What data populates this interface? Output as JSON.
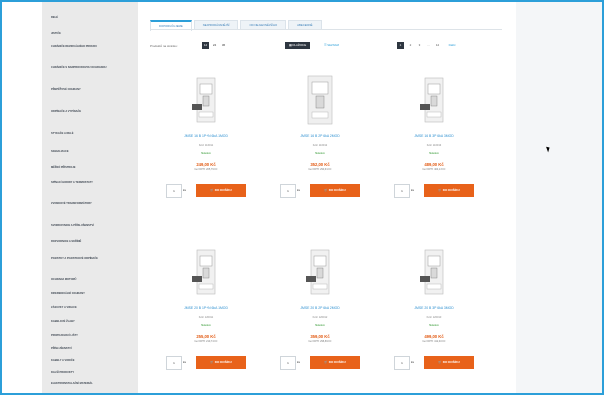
{
  "sidebar": {
    "items": [
      {
        "label": "RELÉ"
      },
      {
        "label": "JISTIČE"
      },
      {
        "label": "CHRÁNIČE REZIDUÁLNÍHO PROUDU"
      },
      {
        "label": "CHRÁNIČE S NADPROUDOVOU OCHRANOU"
      },
      {
        "label": "PŘEPĚŤOVÉ OCHRANY"
      },
      {
        "label": "ODPÍNAČE A VYPÍNAČE"
      },
      {
        "label": "STYKAČE A RELÉ"
      },
      {
        "label": "SIGNALIZACE"
      },
      {
        "label": "MĚŘICÍ PŘÍSTROJE"
      },
      {
        "label": "SPÍNACÍ HODINY A TERMOSTATY"
      },
      {
        "label": "ZVONKOVÉ TRANSFORMÁTORY"
      },
      {
        "label": "SVORKOVNICE A PŘÍSLUŠENSTVÍ"
      },
      {
        "label": "ROZVODNICE A SKŘÍNĚ"
      },
      {
        "label": "POJISTKY A POJISTKOVÉ ODPÍNAČE"
      },
      {
        "label": "OCHRANA MOTORŮ"
      },
      {
        "label": "DIFERENCIÁLNÍ OCHRANY"
      },
      {
        "label": "ZÁSUVKY A VIDLICE"
      },
      {
        "label": "KABELOVÉ ŽLABY"
      },
      {
        "label": "PROPOJOVACÍ LIŠTY"
      },
      {
        "label": "PŘÍSLUŠENSTVÍ"
      },
      {
        "label": "KABELY A VODIČE"
      },
      {
        "label": "DALŠÍ PRODUKTY"
      },
      {
        "label": "ELEKTROINSTALAČNÍ MATERIÁL"
      }
    ]
  },
  "tabs": [
    {
      "label": "DOPORUČUJEME"
    },
    {
      "label": "NEJPRODÁVANĚJŠÍ"
    },
    {
      "label": "OD NEJLEVNĚJŠÍHO"
    },
    {
      "label": "ABECEDNĚ"
    }
  ],
  "toolbar": {
    "per_page_label": "Produktů na stránku:",
    "per_page": [
      "12",
      "24",
      "36"
    ],
    "grid_label": "DLAŽDICE",
    "list_label": "SEZNAM",
    "pages": [
      "1",
      "2",
      "3",
      "...",
      "12"
    ],
    "next_label": "Další"
  },
  "products": [
    {
      "name": "JMSE 16 B 1P+N 6kA 1MOD",
      "code": "Kód: 116011",
      "stock": "Skladem",
      "price": "249,00 Kč",
      "vat": "bez DPH: 205,79 Kč",
      "qty": "1",
      "unit": "ks",
      "cart_label": "DO KOŠÍKU"
    },
    {
      "name": "JMSE 16 B 2P 6kA 2MOD",
      "code": "Kód: 116012",
      "stock": "Skladem",
      "price": "352,00 Kč",
      "vat": "bez DPH: 290,91 Kč",
      "qty": "1",
      "unit": "ks",
      "cart_label": "DO KOŠÍKU"
    },
    {
      "name": "JMSE 16 B 3P 6kA 3MOD",
      "code": "Kód: 116013",
      "stock": "Skladem",
      "price": "489,00 Kč",
      "vat": "bez DPH: 404,13 Kč",
      "qty": "1",
      "unit": "ks",
      "cart_label": "DO KOŠÍKU"
    },
    {
      "name": "JMSE 20 B 1P+N 6kA 1MOD",
      "code": "Kód: 120011",
      "stock": "Skladem",
      "price": "255,00 Kč",
      "vat": "bez DPH: 210,74 Kč",
      "qty": "1",
      "unit": "ks",
      "cart_label": "DO KOŠÍKU"
    },
    {
      "name": "JMSE 20 B 2P 6kA 2MOD",
      "code": "Kód: 120012",
      "stock": "Skladem",
      "price": "359,00 Kč",
      "vat": "bez DPH: 296,69 Kč",
      "qty": "1",
      "unit": "ks",
      "cart_label": "DO KOŠÍKU"
    },
    {
      "name": "JMSE 20 B 3P 6kA 3MOD",
      "code": "Kód: 120013",
      "stock": "Skladem",
      "price": "499,00 Kč",
      "vat": "bez DPH: 412,40 Kč",
      "qty": "1",
      "unit": "ks",
      "cart_label": "DO KOŠÍKU"
    }
  ],
  "colors": {
    "accent": "#2c9fd9",
    "cart": "#e8621a",
    "price": "#e25a13",
    "stock": "#3a9d3a",
    "sidebar_bg": "#eaeaea"
  }
}
